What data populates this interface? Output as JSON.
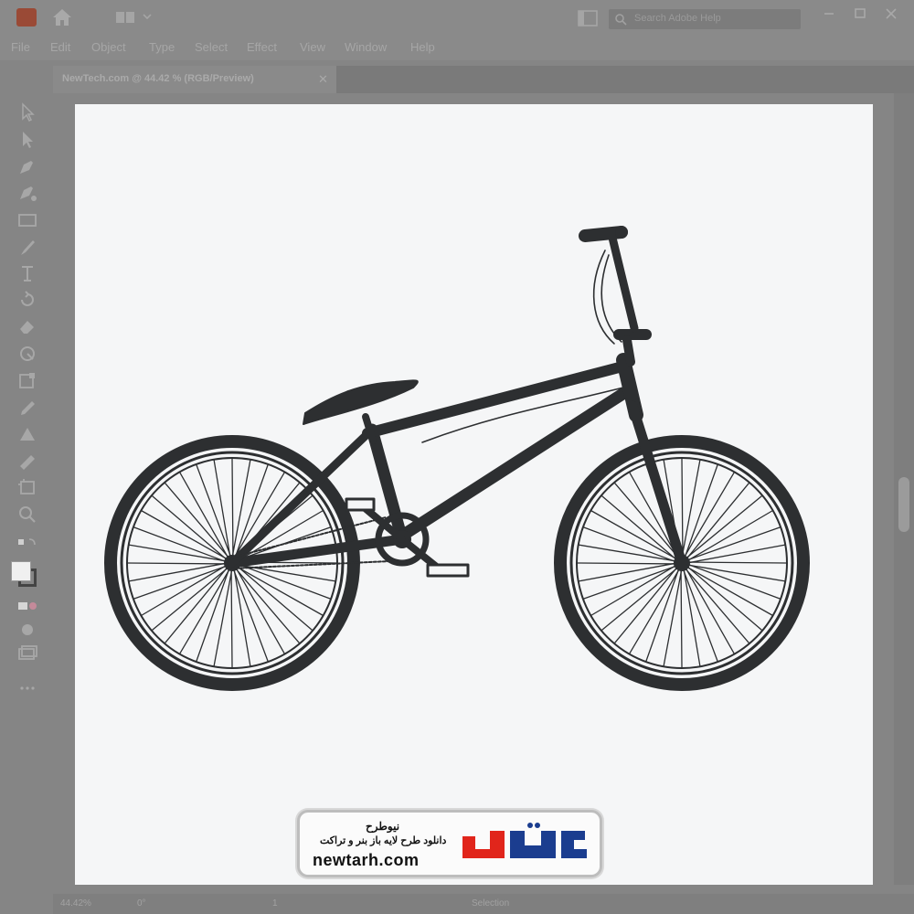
{
  "window": {
    "search_placeholder": "Search Adobe Help"
  },
  "menu": {
    "items": [
      "File",
      "Edit",
      "Object",
      "Type",
      "Select",
      "Effect",
      "View",
      "Window",
      "Help"
    ]
  },
  "document": {
    "tab_title": "NewTech.com @ 44.42 % (RGB/Preview)"
  },
  "status": {
    "zoom": "44.42%",
    "rotation": "0°",
    "artboard_num": "1",
    "mode": "Selection"
  },
  "colors": {
    "bike": "#2d2f31",
    "artboard": "#f5f6f7",
    "watermark_accent": "#e1251b",
    "watermark_blue": "#1b3d8f"
  },
  "watermark": {
    "title": "نیوطرح",
    "subtitle": "دانلود طرح لایه باز بنر و تراکت",
    "url": "newtarh.com",
    "logo_text": "نیوطرح"
  }
}
